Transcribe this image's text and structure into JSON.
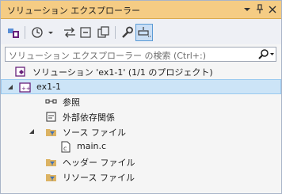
{
  "window": {
    "title": "ソリューション エクスプローラー",
    "menu_glyph": "▾",
    "pin_glyph": "📌",
    "close_glyph": "✕"
  },
  "toolbar": {
    "buttons": [
      {
        "name": "home-switch-icon"
      },
      {
        "name": "history-icon"
      },
      {
        "name": "dropdown-arrow-icon"
      },
      {
        "name": "sync-icon"
      },
      {
        "name": "collapse-all-icon"
      },
      {
        "name": "show-all-files-icon"
      },
      {
        "name": "properties-wrench-icon"
      },
      {
        "name": "preview-selected-icon"
      }
    ]
  },
  "search": {
    "placeholder": "ソリューション エクスプローラー の検索 (Ctrl+:)"
  },
  "tree": {
    "solution": "ソリューション 'ex1-1' (1/1 のプロジェクト)",
    "project": "ex1-1",
    "references": "参照",
    "external_deps": "外部依存関係",
    "source_files": "ソース ファイル",
    "main_c": "main.c",
    "header_files": "ヘッダー ファイル",
    "resource_files": "リソース ファイル"
  },
  "colors": {
    "title_bar": "#f5cc84",
    "selection": "#cce4f7",
    "filter_folder": "#dcb363",
    "project_purple": "#68217a"
  }
}
